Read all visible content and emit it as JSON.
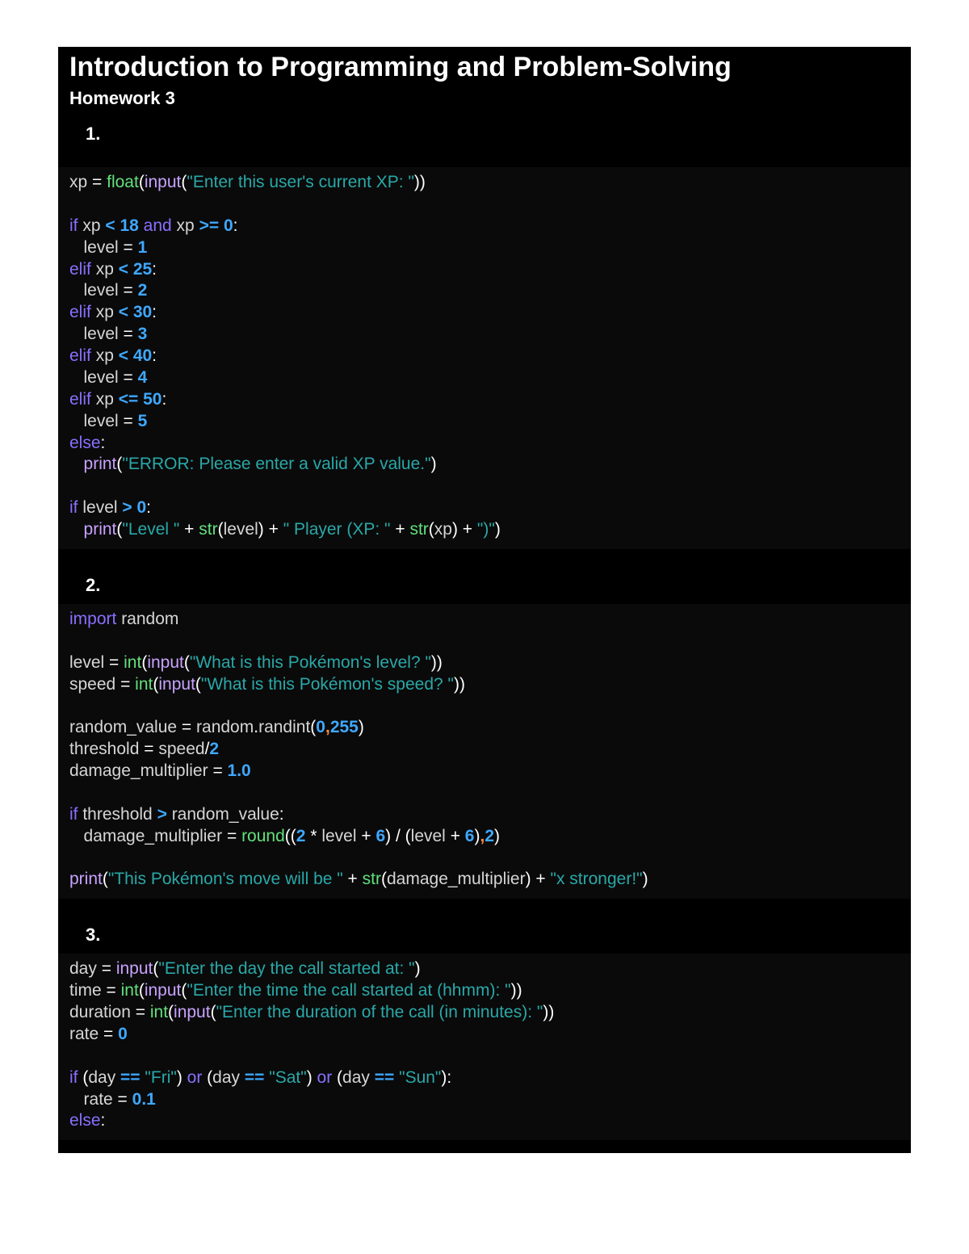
{
  "title": "Introduction to Programming and Problem-Solving",
  "subtitle": "Homework 3",
  "q1": {
    "num": "1.",
    "line1": {
      "xp": "xp ",
      "eq": "= ",
      "float": "float",
      "op": "(",
      "input": "input",
      "op2": "(",
      "str": "\"Enter this user's current XP: \"",
      "cp": "))"
    },
    "l2a": {
      "if": "if ",
      "xp": "xp ",
      "lt": "< ",
      "n": "18",
      "sp": " ",
      "and": "and ",
      "xp2": "xp ",
      "ge": ">= ",
      "z": "0",
      "col": ":"
    },
    "l2b": {
      "ind": "   ",
      "lvl": "level ",
      "eq": "= ",
      "n": "1"
    },
    "l2c": {
      "elif": "elif ",
      "xp": "xp ",
      "lt": "< ",
      "n": "25",
      "col": ":"
    },
    "l2d": {
      "ind": "   ",
      "lvl": "level ",
      "eq": "= ",
      "n": "2"
    },
    "l2e": {
      "elif": "elif ",
      "xp": "xp ",
      "lt": "< ",
      "n": "30",
      "col": ":"
    },
    "l2f": {
      "ind": "   ",
      "lvl": "level ",
      "eq": "= ",
      "n": "3"
    },
    "l2g": {
      "elif": "elif ",
      "xp": "xp ",
      "lt": "< ",
      "n": "40",
      "col": ":"
    },
    "l2h": {
      "ind": "   ",
      "lvl": "level ",
      "eq": "= ",
      "n": "4"
    },
    "l2i": {
      "elif": "elif ",
      "xp": "xp ",
      "le": "<= ",
      "n": "50",
      "col": ":"
    },
    "l2j": {
      "ind": "   ",
      "lvl": "level ",
      "eq": "= ",
      "n": "5"
    },
    "l2k": {
      "else": "else",
      "col": ":"
    },
    "l2l": {
      "ind": "   ",
      "print": "print",
      "op": "(",
      "str": "\"ERROR: Please enter a valid XP value.\"",
      "cp": ")"
    },
    "l3a": {
      "if": "if ",
      "lvl": "level ",
      "gt": "> ",
      "z": "0",
      "col": ":"
    },
    "l3b": {
      "ind": "   ",
      "print": "print",
      "op": "(",
      "s1": "\"Level \"",
      "p1": " + ",
      "str": "str",
      "op2": "(",
      "lvl": "level",
      "cp1": ") ",
      "p2": "+ ",
      "s2": "\" Player (XP: \"",
      "p3": " + ",
      "str2": "str",
      "op3": "(",
      "xp": "xp",
      "cp2": ") ",
      "p4": "+ ",
      "s3": "\")\"",
      "cp3": ")"
    }
  },
  "q2": {
    "num": "2.",
    "l1": {
      "import": "import ",
      "mod": "random"
    },
    "l2": {
      "lvl": "level ",
      "eq": "= ",
      "int": "int",
      "op": "(",
      "input": "input",
      "op2": "(",
      "str": "\"What is this Pokémon's level? \"",
      "cp": "))"
    },
    "l3": {
      "spd": "speed ",
      "eq": "= ",
      "int": "int",
      "op": "(",
      "input": "input",
      "op2": "(",
      "str": "\"What is this Pokémon's speed? \"",
      "cp": "))"
    },
    "l4": {
      "rv": "random_value ",
      "eq": "= ",
      "mod": "random",
      "dot": ".",
      "fn": "randint",
      "op": "(",
      "n1": "0",
      "c": ",",
      "n2": "255",
      "cp": ")"
    },
    "l5": {
      "th": "threshold ",
      "eq": "= ",
      "spd": "speed",
      "div": "/",
      "n": "2"
    },
    "l6": {
      "dm": "damage_multiplier ",
      "eq": "= ",
      "n": "1.0"
    },
    "l7": {
      "if": "if ",
      "th": "threshold ",
      "gt": "> ",
      "rv": "random_value",
      "col": ":"
    },
    "l8": {
      "ind": "   ",
      "dm": "damage_multiplier ",
      "eq": "= ",
      "round": "round",
      "op": "((",
      "n2": "2",
      "sp": " ",
      "mul": "* ",
      "lvl": "level ",
      "plus": "+ ",
      "n6": "6",
      "cp1": ") ",
      "div": "/ ",
      "op2": "(",
      "lvl2": "level ",
      "plus2": "+ ",
      "n6b": "6",
      "cp2": ")",
      "c": ",",
      "n2b": "2",
      "cp3": ")"
    },
    "l9": {
      "print": "print",
      "op": "(",
      "s1": "\"This Pokémon's move will be \"",
      "p1": " + ",
      "str": "str",
      "op2": "(",
      "dm": "damage_multiplier",
      "cp1": ") ",
      "p2": "+ ",
      "s2": "\"x stronger!\"",
      "cp2": ")"
    }
  },
  "q3": {
    "num": "3.",
    "l1": {
      "day": "day ",
      "eq": "= ",
      "input": "input",
      "op": "(",
      "str": "\"Enter the day the call started at: \"",
      "cp": ")"
    },
    "l2": {
      "time": "time ",
      "eq": "= ",
      "int": "int",
      "op": "(",
      "input": "input",
      "op2": "(",
      "str": "\"Enter the time the call started at (hhmm): \"",
      "cp": "))"
    },
    "l3": {
      "dur": "duration ",
      "eq": "= ",
      "int": "int",
      "op": "(",
      "input": "input",
      "op2": "(",
      "str": "\"Enter the duration of the call (in minutes): \"",
      "cp": "))"
    },
    "l4": {
      "rate": "rate ",
      "eq": "= ",
      "n": "0"
    },
    "l5": {
      "if": "if ",
      "op1": "(",
      "day": "day ",
      "eqeq": "== ",
      "s1": "\"Fri\"",
      "cp1": ") ",
      "or1": "or ",
      "op2": "(",
      "day2": "day ",
      "eqeq2": "== ",
      "s2": "\"Sat\"",
      "cp2": ") ",
      "or2": "or ",
      "op3": "(",
      "day3": "day ",
      "eqeq3": "== ",
      "s3": "\"Sun\"",
      "cp3": ")",
      "col": ":"
    },
    "l6": {
      "ind": "   ",
      "rate": "rate ",
      "eq": "= ",
      "n": "0.1"
    },
    "l7": {
      "else": "else",
      "col": ":"
    }
  }
}
